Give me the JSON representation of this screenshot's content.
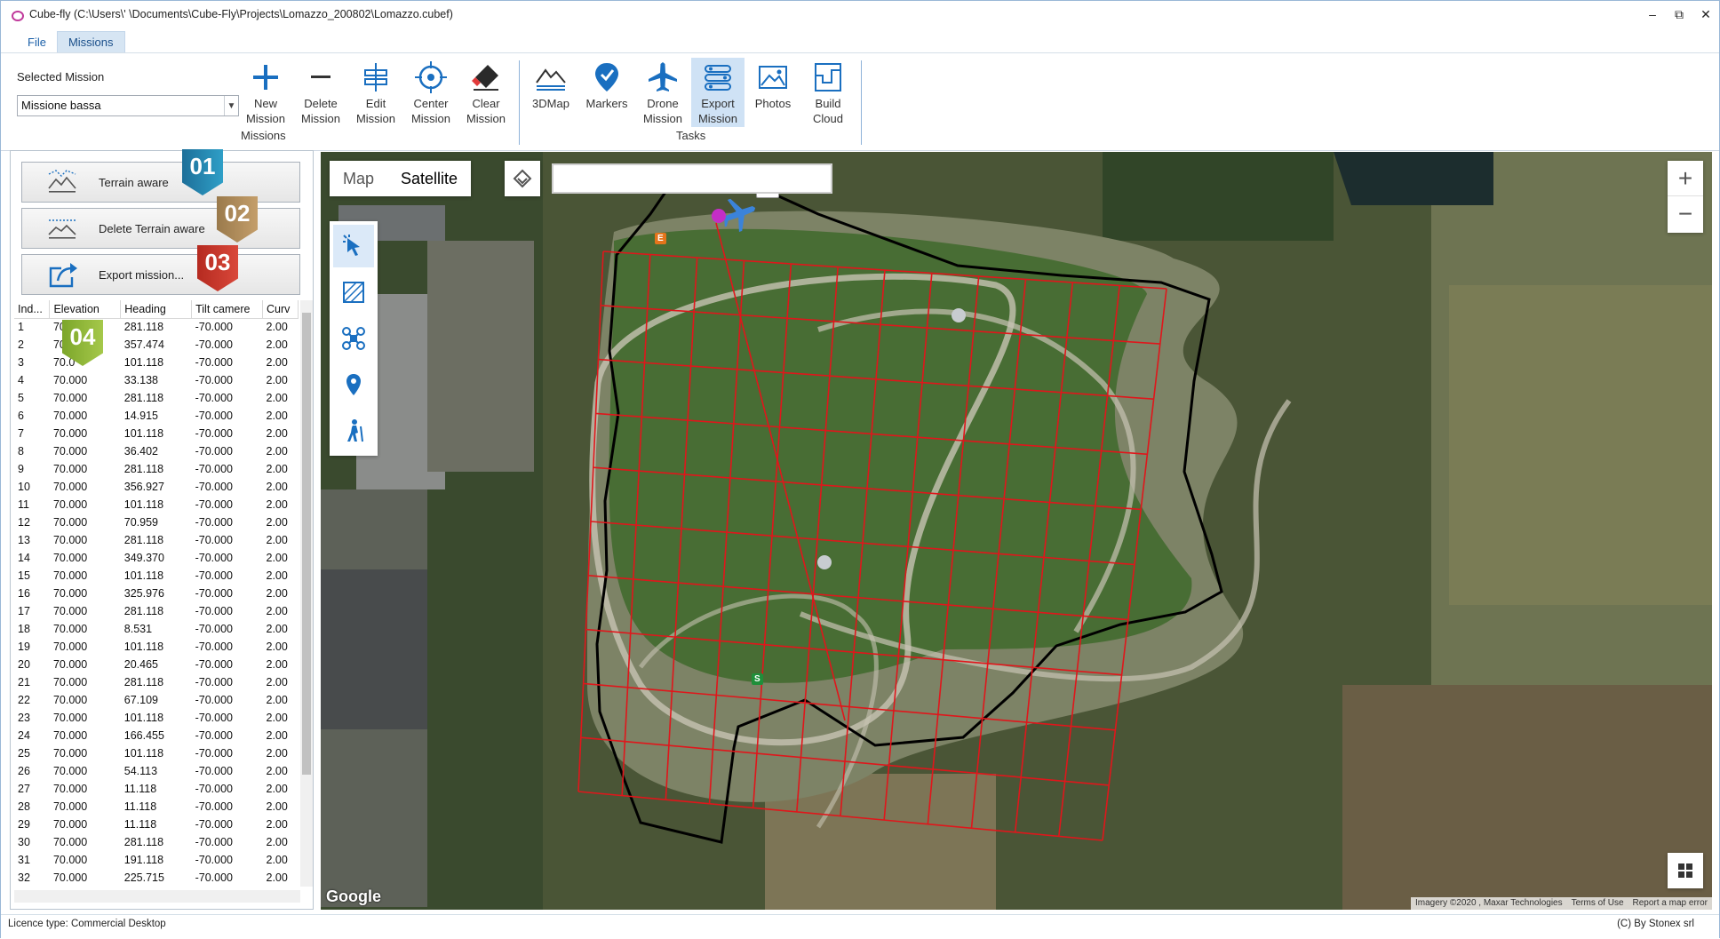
{
  "window": {
    "title": "Cube-fly (C:\\Users\\'          \\Documents\\Cube-Fly\\Projects\\Lomazzo_200802\\Lomazzo.cubef)",
    "controls": [
      "–",
      "⧉",
      "✕"
    ]
  },
  "menu": {
    "file": "File",
    "missions": "Missions"
  },
  "ribbon": {
    "selected_mission_label": "Selected Mission",
    "selected_mission_value": "Missione bassa",
    "missions_group": "Missions",
    "tasks_group": "Tasks",
    "buttons": {
      "new": [
        "New",
        "Mission"
      ],
      "delete": [
        "Delete",
        "Mission"
      ],
      "edit": [
        "Edit",
        "Mission"
      ],
      "center": [
        "Center",
        "Mission"
      ],
      "clear": [
        "Clear",
        "Mission"
      ],
      "map3d": [
        "3DMap",
        ""
      ],
      "markers": [
        "Markers",
        ""
      ],
      "drone": [
        "Drone",
        "Mission"
      ],
      "export": [
        "Export",
        "Mission"
      ],
      "photos": [
        "Photos",
        ""
      ],
      "cloud": [
        "Build",
        "Cloud"
      ]
    }
  },
  "left_panel": {
    "terrain_aware": "Terrain aware",
    "delete_terrain_aware": "Delete Terrain aware",
    "export_mission": "Export mission...",
    "badges": [
      "01",
      "02",
      "03",
      "04"
    ],
    "columns": [
      "Ind...",
      "Elevation",
      "Heading",
      "Tilt camere",
      "Curv"
    ],
    "rows": [
      [
        "1",
        "70",
        "281.118",
        "-70.000",
        "2.00"
      ],
      [
        "2",
        "70",
        "357.474",
        "-70.000",
        "2.00"
      ],
      [
        "3",
        "70.0",
        "101.118",
        "-70.000",
        "2.00"
      ],
      [
        "4",
        "70.000",
        "33.138",
        "-70.000",
        "2.00"
      ],
      [
        "5",
        "70.000",
        "281.118",
        "-70.000",
        "2.00"
      ],
      [
        "6",
        "70.000",
        "14.915",
        "-70.000",
        "2.00"
      ],
      [
        "7",
        "70.000",
        "101.118",
        "-70.000",
        "2.00"
      ],
      [
        "8",
        "70.000",
        "36.402",
        "-70.000",
        "2.00"
      ],
      [
        "9",
        "70.000",
        "281.118",
        "-70.000",
        "2.00"
      ],
      [
        "10",
        "70.000",
        "356.927",
        "-70.000",
        "2.00"
      ],
      [
        "11",
        "70.000",
        "101.118",
        "-70.000",
        "2.00"
      ],
      [
        "12",
        "70.000",
        "70.959",
        "-70.000",
        "2.00"
      ],
      [
        "13",
        "70.000",
        "281.118",
        "-70.000",
        "2.00"
      ],
      [
        "14",
        "70.000",
        "349.370",
        "-70.000",
        "2.00"
      ],
      [
        "15",
        "70.000",
        "101.118",
        "-70.000",
        "2.00"
      ],
      [
        "16",
        "70.000",
        "325.976",
        "-70.000",
        "2.00"
      ],
      [
        "17",
        "70.000",
        "281.118",
        "-70.000",
        "2.00"
      ],
      [
        "18",
        "70.000",
        "8.531",
        "-70.000",
        "2.00"
      ],
      [
        "19",
        "70.000",
        "101.118",
        "-70.000",
        "2.00"
      ],
      [
        "20",
        "70.000",
        "20.465",
        "-70.000",
        "2.00"
      ],
      [
        "21",
        "70.000",
        "281.118",
        "-70.000",
        "2.00"
      ],
      [
        "22",
        "70.000",
        "67.109",
        "-70.000",
        "2.00"
      ],
      [
        "23",
        "70.000",
        "101.118",
        "-70.000",
        "2.00"
      ],
      [
        "24",
        "70.000",
        "166.455",
        "-70.000",
        "2.00"
      ],
      [
        "25",
        "70.000",
        "101.118",
        "-70.000",
        "2.00"
      ],
      [
        "26",
        "70.000",
        "54.113",
        "-70.000",
        "2.00"
      ],
      [
        "27",
        "70.000",
        "11.118",
        "-70.000",
        "2.00"
      ],
      [
        "28",
        "70.000",
        "11.118",
        "-70.000",
        "2.00"
      ],
      [
        "29",
        "70.000",
        "11.118",
        "-70.000",
        "2.00"
      ],
      [
        "30",
        "70.000",
        "281.118",
        "-70.000",
        "2.00"
      ],
      [
        "31",
        "70.000",
        "191.118",
        "-70.000",
        "2.00"
      ],
      [
        "32",
        "70.000",
        "225.715",
        "-70.000",
        "2.00"
      ]
    ]
  },
  "map": {
    "type_map": "Map",
    "type_satellite": "Satellite",
    "search_value": "",
    "tilt_tag": "-70°",
    "end_tag": "E",
    "start_tag": "S",
    "zoom_in": "+",
    "zoom_out": "−",
    "logo": "Google",
    "attribution": [
      "Imagery ©2020 , Maxar Technologies",
      "Terms of Use",
      "Report a map error"
    ]
  },
  "status": {
    "licence": "Licence type: Commercial Desktop",
    "copyright": "(C) By Stonex srl"
  },
  "colors": {
    "accent": "#1a6fc0",
    "flight_path": "#e0161b",
    "boundary": "#000000"
  }
}
